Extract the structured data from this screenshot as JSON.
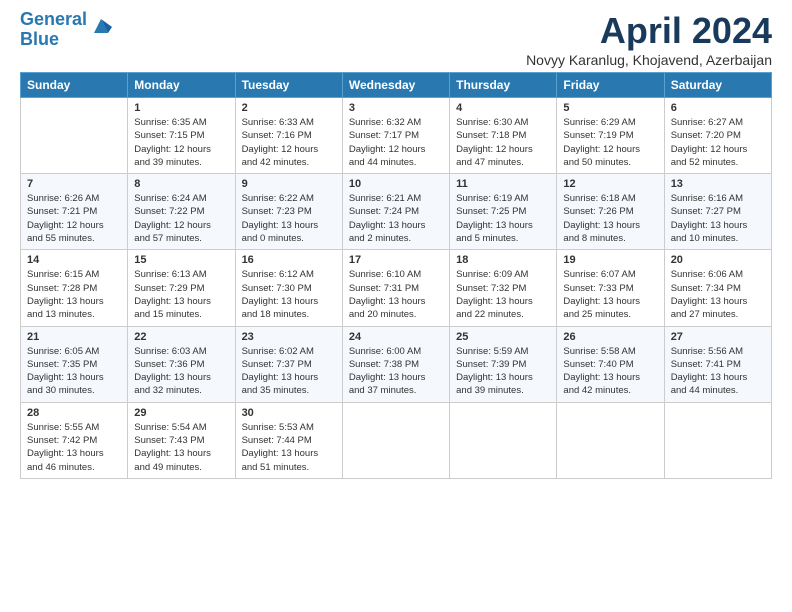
{
  "header": {
    "logo_line1": "General",
    "logo_line2": "Blue",
    "title": "April 2024",
    "subtitle": "Novyy Karanlug, Khojavend, Azerbaijan"
  },
  "calendar": {
    "days_of_week": [
      "Sunday",
      "Monday",
      "Tuesday",
      "Wednesday",
      "Thursday",
      "Friday",
      "Saturday"
    ],
    "weeks": [
      [
        {
          "day": "",
          "info": ""
        },
        {
          "day": "1",
          "info": "Sunrise: 6:35 AM\nSunset: 7:15 PM\nDaylight: 12 hours\nand 39 minutes."
        },
        {
          "day": "2",
          "info": "Sunrise: 6:33 AM\nSunset: 7:16 PM\nDaylight: 12 hours\nand 42 minutes."
        },
        {
          "day": "3",
          "info": "Sunrise: 6:32 AM\nSunset: 7:17 PM\nDaylight: 12 hours\nand 44 minutes."
        },
        {
          "day": "4",
          "info": "Sunrise: 6:30 AM\nSunset: 7:18 PM\nDaylight: 12 hours\nand 47 minutes."
        },
        {
          "day": "5",
          "info": "Sunrise: 6:29 AM\nSunset: 7:19 PM\nDaylight: 12 hours\nand 50 minutes."
        },
        {
          "day": "6",
          "info": "Sunrise: 6:27 AM\nSunset: 7:20 PM\nDaylight: 12 hours\nand 52 minutes."
        }
      ],
      [
        {
          "day": "7",
          "info": "Sunrise: 6:26 AM\nSunset: 7:21 PM\nDaylight: 12 hours\nand 55 minutes."
        },
        {
          "day": "8",
          "info": "Sunrise: 6:24 AM\nSunset: 7:22 PM\nDaylight: 12 hours\nand 57 minutes."
        },
        {
          "day": "9",
          "info": "Sunrise: 6:22 AM\nSunset: 7:23 PM\nDaylight: 13 hours\nand 0 minutes."
        },
        {
          "day": "10",
          "info": "Sunrise: 6:21 AM\nSunset: 7:24 PM\nDaylight: 13 hours\nand 2 minutes."
        },
        {
          "day": "11",
          "info": "Sunrise: 6:19 AM\nSunset: 7:25 PM\nDaylight: 13 hours\nand 5 minutes."
        },
        {
          "day": "12",
          "info": "Sunrise: 6:18 AM\nSunset: 7:26 PM\nDaylight: 13 hours\nand 8 minutes."
        },
        {
          "day": "13",
          "info": "Sunrise: 6:16 AM\nSunset: 7:27 PM\nDaylight: 13 hours\nand 10 minutes."
        }
      ],
      [
        {
          "day": "14",
          "info": "Sunrise: 6:15 AM\nSunset: 7:28 PM\nDaylight: 13 hours\nand 13 minutes."
        },
        {
          "day": "15",
          "info": "Sunrise: 6:13 AM\nSunset: 7:29 PM\nDaylight: 13 hours\nand 15 minutes."
        },
        {
          "day": "16",
          "info": "Sunrise: 6:12 AM\nSunset: 7:30 PM\nDaylight: 13 hours\nand 18 minutes."
        },
        {
          "day": "17",
          "info": "Sunrise: 6:10 AM\nSunset: 7:31 PM\nDaylight: 13 hours\nand 20 minutes."
        },
        {
          "day": "18",
          "info": "Sunrise: 6:09 AM\nSunset: 7:32 PM\nDaylight: 13 hours\nand 22 minutes."
        },
        {
          "day": "19",
          "info": "Sunrise: 6:07 AM\nSunset: 7:33 PM\nDaylight: 13 hours\nand 25 minutes."
        },
        {
          "day": "20",
          "info": "Sunrise: 6:06 AM\nSunset: 7:34 PM\nDaylight: 13 hours\nand 27 minutes."
        }
      ],
      [
        {
          "day": "21",
          "info": "Sunrise: 6:05 AM\nSunset: 7:35 PM\nDaylight: 13 hours\nand 30 minutes."
        },
        {
          "day": "22",
          "info": "Sunrise: 6:03 AM\nSunset: 7:36 PM\nDaylight: 13 hours\nand 32 minutes."
        },
        {
          "day": "23",
          "info": "Sunrise: 6:02 AM\nSunset: 7:37 PM\nDaylight: 13 hours\nand 35 minutes."
        },
        {
          "day": "24",
          "info": "Sunrise: 6:00 AM\nSunset: 7:38 PM\nDaylight: 13 hours\nand 37 minutes."
        },
        {
          "day": "25",
          "info": "Sunrise: 5:59 AM\nSunset: 7:39 PM\nDaylight: 13 hours\nand 39 minutes."
        },
        {
          "day": "26",
          "info": "Sunrise: 5:58 AM\nSunset: 7:40 PM\nDaylight: 13 hours\nand 42 minutes."
        },
        {
          "day": "27",
          "info": "Sunrise: 5:56 AM\nSunset: 7:41 PM\nDaylight: 13 hours\nand 44 minutes."
        }
      ],
      [
        {
          "day": "28",
          "info": "Sunrise: 5:55 AM\nSunset: 7:42 PM\nDaylight: 13 hours\nand 46 minutes."
        },
        {
          "day": "29",
          "info": "Sunrise: 5:54 AM\nSunset: 7:43 PM\nDaylight: 13 hours\nand 49 minutes."
        },
        {
          "day": "30",
          "info": "Sunrise: 5:53 AM\nSunset: 7:44 PM\nDaylight: 13 hours\nand 51 minutes."
        },
        {
          "day": "",
          "info": ""
        },
        {
          "day": "",
          "info": ""
        },
        {
          "day": "",
          "info": ""
        },
        {
          "day": "",
          "info": ""
        }
      ]
    ]
  }
}
